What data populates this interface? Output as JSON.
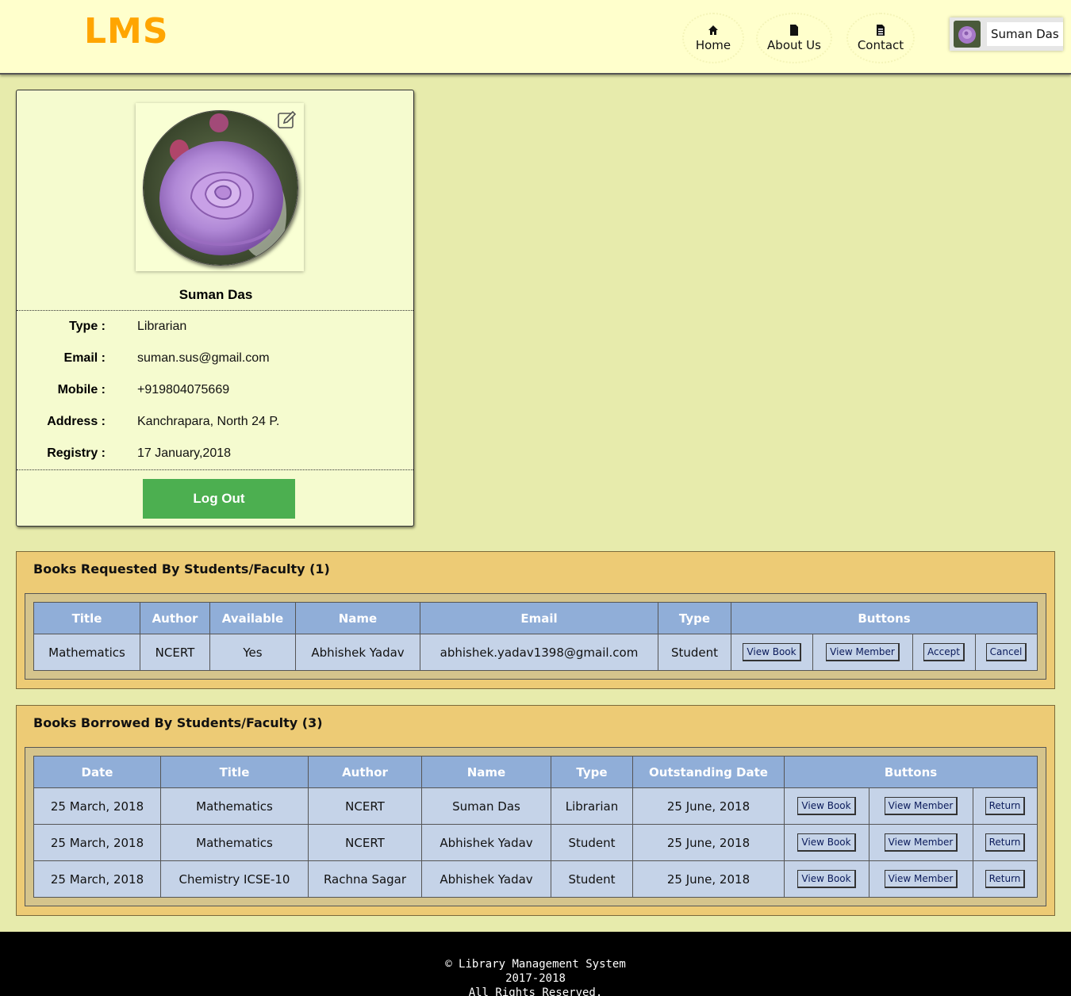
{
  "header": {
    "logo": "LMS",
    "nav": [
      {
        "label": "Home",
        "icon": "home-icon"
      },
      {
        "label": "About Us",
        "icon": "file-icon"
      },
      {
        "label": "Contact",
        "icon": "list-file-icon"
      }
    ],
    "user_name": "Suman Das"
  },
  "profile": {
    "name": "Suman Das",
    "fields": [
      {
        "key": "Type :",
        "value": "Librarian"
      },
      {
        "key": "Email :",
        "value": "suman.sus@gmail.com"
      },
      {
        "key": "Mobile :",
        "value": "+919804075669"
      },
      {
        "key": "Address :",
        "value": "Kanchrapara, North 24 P."
      },
      {
        "key": "Registry :",
        "value": "17 January,2018"
      }
    ],
    "logout_label": "Log Out"
  },
  "requested": {
    "title": "Books Requested By Students/Faculty (1)",
    "headers": [
      "Title",
      "Author",
      "Available",
      "Name",
      "Email",
      "Type",
      "Buttons"
    ],
    "rows": [
      {
        "title": "Mathematics",
        "author": "NCERT",
        "available": "Yes",
        "name": "Abhishek Yadav",
        "email": "abhishek.yadav1398@gmail.com",
        "type": "Student"
      }
    ],
    "buttons": {
      "view_book": "View Book",
      "view_member": "View Member",
      "accept": "Accept",
      "cancel": "Cancel"
    }
  },
  "borrowed": {
    "title": "Books Borrowed By Students/Faculty (3)",
    "headers": [
      "Date",
      "Title",
      "Author",
      "Name",
      "Type",
      "Outstanding Date",
      "Buttons"
    ],
    "rows": [
      {
        "date": "25 March, 2018",
        "title": "Mathematics",
        "author": "NCERT",
        "name": "Suman Das",
        "type": "Librarian",
        "outstanding": "25 June, 2018"
      },
      {
        "date": "25 March, 2018",
        "title": "Mathematics",
        "author": "NCERT",
        "name": "Abhishek Yadav",
        "type": "Student",
        "outstanding": "25 June, 2018"
      },
      {
        "date": "25 March, 2018",
        "title": "Chemistry ICSE-10",
        "author": "Rachna Sagar",
        "name": "Abhishek Yadav",
        "type": "Student",
        "outstanding": "25 June, 2018"
      }
    ],
    "buttons": {
      "view_book": "View Book",
      "view_member": "View Member",
      "return": "Return"
    }
  },
  "footer": {
    "line1": "© Library Management System",
    "line2": "2017-2018",
    "line3": "All Rights Reserved."
  },
  "colors": {
    "page_bg": "#e7ebac",
    "header_bg": "#ffffcc",
    "logo": "#ffa500",
    "logout": "#4caf50",
    "section_bg": "#edcb75",
    "table_header": "#90aed8",
    "table_cell": "#c5d3e8"
  }
}
